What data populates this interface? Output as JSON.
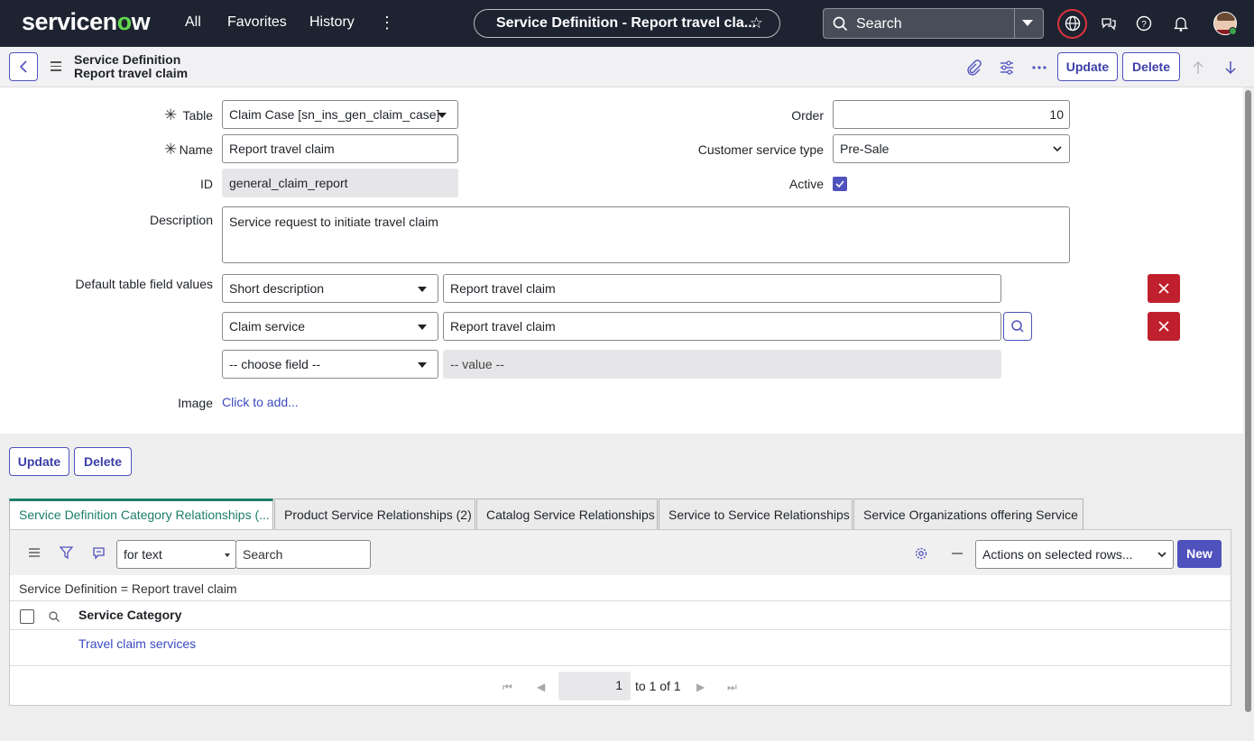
{
  "nav": {
    "logo_pre": "servicen",
    "logo_o": "o",
    "logo_post": "w",
    "all": "All",
    "favorites": "Favorites",
    "history": "History",
    "context_title": "Service Definition - Report travel cla...",
    "search_placeholder": "Search"
  },
  "header": {
    "line1": "Service Definition",
    "line2": "Report travel claim",
    "update_label": "Update",
    "delete_label": "Delete"
  },
  "form": {
    "table_label": "Table",
    "table_value": "Claim Case [sn_ins_gen_claim_case]",
    "name_label": "Name",
    "name_value": "Report travel claim",
    "id_label": "ID",
    "id_value": "general_claim_report",
    "order_label": "Order",
    "order_value": "10",
    "cst_label": "Customer service type",
    "cst_value": "Pre-Sale",
    "active_label": "Active",
    "active_checked": true,
    "description_label": "Description",
    "description_value": "Service request to initiate travel claim",
    "defaults_label": "Default table field values",
    "default_rows": [
      {
        "field": "Short description",
        "value": "Report travel claim"
      },
      {
        "field": "Claim service",
        "value": "Report travel claim"
      },
      {
        "field": "-- choose field --",
        "value": "-- value --"
      }
    ],
    "image_label": "Image",
    "image_link": "Click to add..."
  },
  "bottom_buttons": {
    "update_label": "Update",
    "delete_label": "Delete"
  },
  "tabs": [
    {
      "label": "Service Definition Category Relationships (..."
    },
    {
      "label": "Product Service Relationships (2)"
    },
    {
      "label": "Catalog Service Relationships"
    },
    {
      "label": "Service to Service Relationships"
    },
    {
      "label": "Service Organizations offering Service"
    }
  ],
  "related_list": {
    "filter_select": "for text",
    "search_placeholder": "Search",
    "actions_select": "Actions on selected rows...",
    "new_label": "New",
    "condition": "Service Definition = Report travel claim",
    "column_header": "Service Category",
    "rows": [
      "Travel claim services"
    ],
    "page_value": "1",
    "page_text": "to 1 of 1"
  },
  "colors": {
    "nav_bg": "#1d2330",
    "accent": "#4f52bd",
    "delete_red": "#c0202d",
    "tab_active": "#1c7f6a",
    "link": "#3b49c2"
  }
}
